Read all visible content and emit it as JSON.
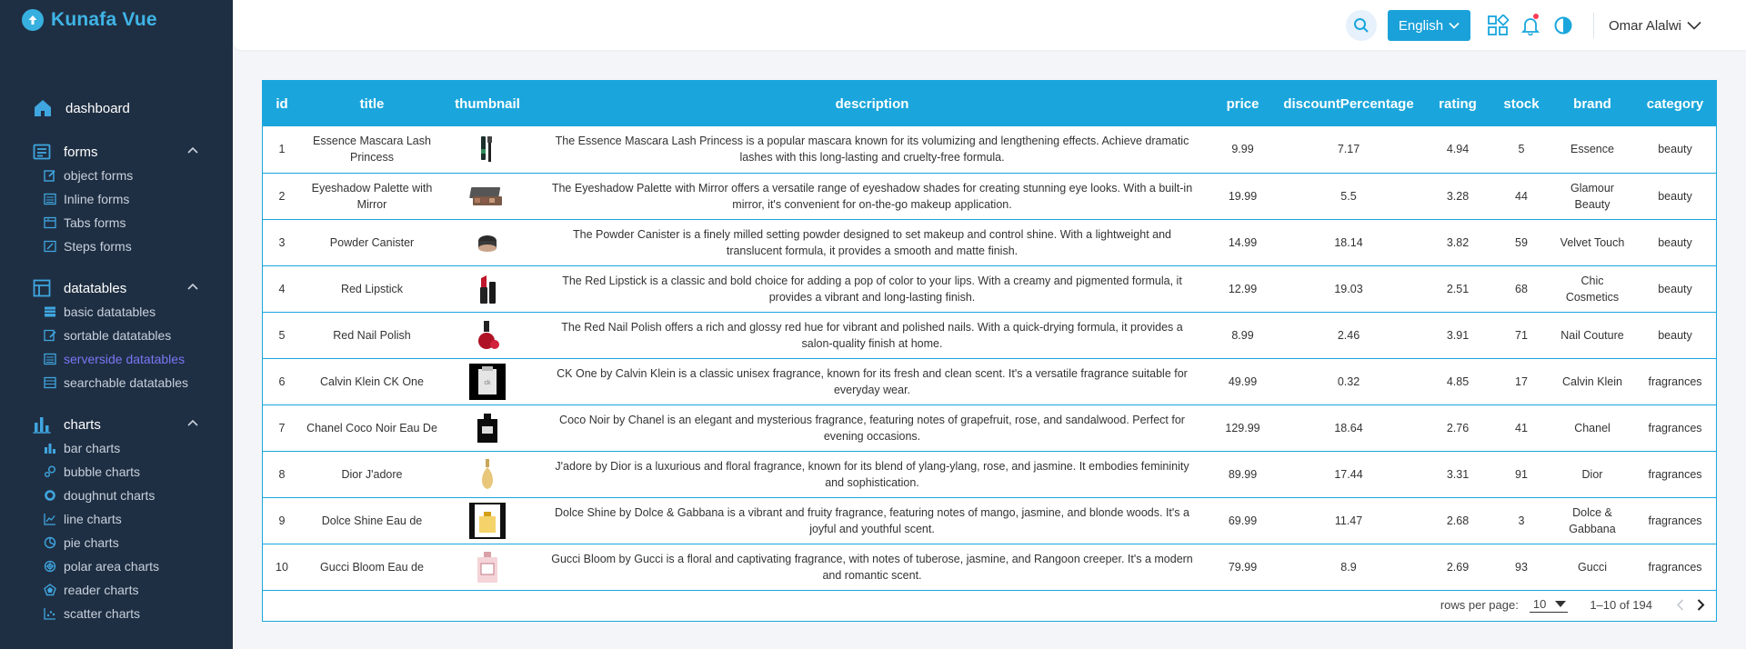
{
  "brand": {
    "name": "Kunafa Vue"
  },
  "nav": {
    "dashboard": "dashboard",
    "groups": [
      {
        "label": "forms",
        "items": [
          "object forms",
          "Inline forms",
          "Tabs forms",
          "Steps forms"
        ]
      },
      {
        "label": "datatables",
        "items": [
          "basic datatables",
          "sortable datatables",
          "serverside datatables",
          "searchable datatables"
        ],
        "active_index": 2
      },
      {
        "label": "charts",
        "items": [
          "bar charts",
          "bubble charts",
          "doughnut charts",
          "line charts",
          "pie charts",
          "polar area charts",
          "reader charts",
          "scatter charts"
        ]
      }
    ]
  },
  "header": {
    "language": "English",
    "user": "Omar Alalwi"
  },
  "colors": {
    "sidebar": "#1f2f43",
    "accent": "#1aa6dc",
    "brand": "#3fb4e6",
    "active_nav": "#7b76f4",
    "notification_dot": "#ff3b55"
  },
  "table": {
    "columns": [
      "id",
      "title",
      "thumbnail",
      "description",
      "price",
      "discountPercentage",
      "rating",
      "stock",
      "brand",
      "category"
    ],
    "rows": [
      {
        "id": "1",
        "title": "Essence Mascara Lash Princess",
        "thumb": "mascara",
        "description": "The Essence Mascara Lash Princess is a popular mascara known for its volumizing and lengthening effects. Achieve dramatic lashes with this long-lasting and cruelty-free formula.",
        "price": "9.99",
        "discount": "7.17",
        "rating": "4.94",
        "stock": "5",
        "brand": "Essence",
        "category": "beauty"
      },
      {
        "id": "2",
        "title": "Eyeshadow Palette with Mirror",
        "thumb": "palette",
        "description": "The Eyeshadow Palette with Mirror offers a versatile range of eyeshadow shades for creating stunning eye looks. With a built-in mirror, it's convenient for on-the-go makeup application.",
        "price": "19.99",
        "discount": "5.5",
        "rating": "3.28",
        "stock": "44",
        "brand": "Glamour Beauty",
        "category": "beauty"
      },
      {
        "id": "3",
        "title": "Powder Canister",
        "thumb": "powder",
        "description": "The Powder Canister is a finely milled setting powder designed to set makeup and control shine. With a lightweight and translucent formula, it provides a smooth and matte finish.",
        "price": "14.99",
        "discount": "18.14",
        "rating": "3.82",
        "stock": "59",
        "brand": "Velvet Touch",
        "category": "beauty"
      },
      {
        "id": "4",
        "title": "Red Lipstick",
        "thumb": "lipstick",
        "description": "The Red Lipstick is a classic and bold choice for adding a pop of color to your lips. With a creamy and pigmented formula, it provides a vibrant and long-lasting finish.",
        "price": "12.99",
        "discount": "19.03",
        "rating": "2.51",
        "stock": "68",
        "brand": "Chic Cosmetics",
        "category": "beauty"
      },
      {
        "id": "5",
        "title": "Red Nail Polish",
        "thumb": "nailpolish",
        "description": "The Red Nail Polish offers a rich and glossy red hue for vibrant and polished nails. With a quick-drying formula, it provides a salon-quality finish at home.",
        "price": "8.99",
        "discount": "2.46",
        "rating": "3.91",
        "stock": "71",
        "brand": "Nail Couture",
        "category": "beauty"
      },
      {
        "id": "6",
        "title": "Calvin Klein CK One",
        "thumb": "ckone",
        "description": "CK One by Calvin Klein is a classic unisex fragrance, known for its fresh and clean scent. It's a versatile fragrance suitable for everyday wear.",
        "price": "49.99",
        "discount": "0.32",
        "rating": "4.85",
        "stock": "17",
        "brand": "Calvin Klein",
        "category": "fragrances"
      },
      {
        "id": "7",
        "title": "Chanel Coco Noir Eau De",
        "thumb": "chanel",
        "description": "Coco Noir by Chanel is an elegant and mysterious fragrance, featuring notes of grapefruit, rose, and sandalwood. Perfect for evening occasions.",
        "price": "129.99",
        "discount": "18.64",
        "rating": "2.76",
        "stock": "41",
        "brand": "Chanel",
        "category": "fragrances"
      },
      {
        "id": "8",
        "title": "Dior J'adore",
        "thumb": "dior",
        "description": "J'adore by Dior is a luxurious and floral fragrance, known for its blend of ylang-ylang, rose, and jasmine. It embodies femininity and sophistication.",
        "price": "89.99",
        "discount": "17.44",
        "rating": "3.31",
        "stock": "91",
        "brand": "Dior",
        "category": "fragrances"
      },
      {
        "id": "9",
        "title": "Dolce Shine Eau de",
        "thumb": "dolce",
        "description": "Dolce Shine by Dolce & Gabbana is a vibrant and fruity fragrance, featuring notes of mango, jasmine, and blonde woods. It's a joyful and youthful scent.",
        "price": "69.99",
        "discount": "11.47",
        "rating": "2.68",
        "stock": "3",
        "brand": "Dolce & Gabbana",
        "category": "fragrances"
      },
      {
        "id": "10",
        "title": "Gucci Bloom Eau de",
        "thumb": "gucci",
        "description": "Gucci Bloom by Gucci is a floral and captivating fragrance, with notes of tuberose, jasmine, and Rangoon creeper. It's a modern and romantic scent.",
        "price": "79.99",
        "discount": "8.9",
        "rating": "2.69",
        "stock": "93",
        "brand": "Gucci",
        "category": "fragrances"
      }
    ]
  },
  "pagination": {
    "rows_per_page_label": "rows per page:",
    "rows_per_page": "10",
    "range": "1–10 of 194"
  }
}
